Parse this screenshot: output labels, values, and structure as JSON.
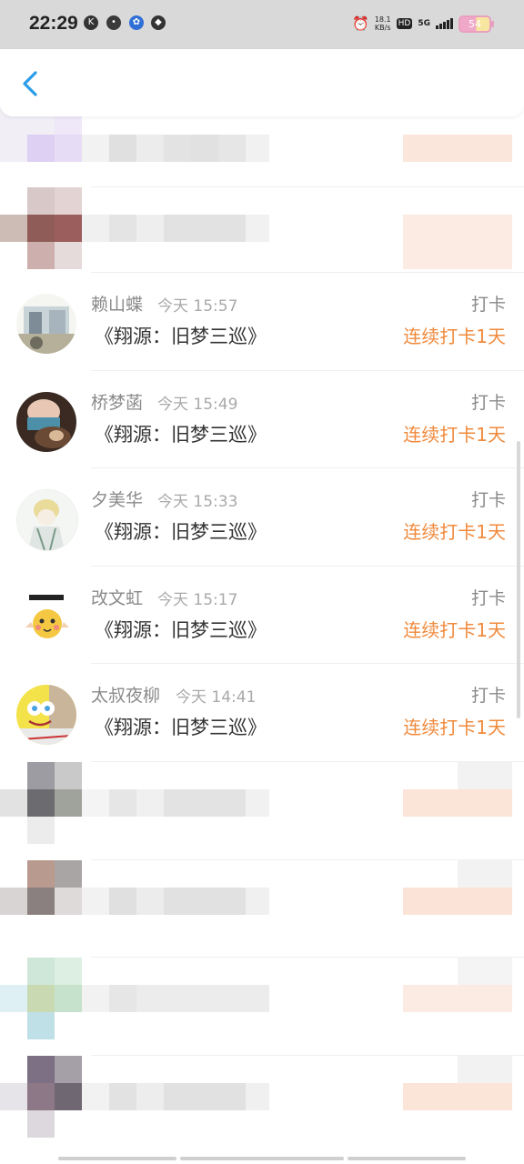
{
  "status_bar": {
    "time": "22:29",
    "net_speed": "18.1",
    "net_unit": "KB/s",
    "hd": "HD",
    "network": "5G",
    "battery": "54"
  },
  "header": {
    "back_icon": "chevron-left-icon",
    "accent_color": "#2a9de8"
  },
  "rows": [
    {
      "name": "赖山蝶",
      "time": "今天 15:57",
      "title": "《翔源：旧梦三巡》",
      "action": "打卡",
      "streak": "连续打卡1天"
    },
    {
      "name": "桥梦菡",
      "time": "今天 15:49",
      "title": "《翔源：旧梦三巡》",
      "action": "打卡",
      "streak": "连续打卡1天"
    },
    {
      "name": "夕美华",
      "time": "今天 15:33",
      "title": "《翔源：旧梦三巡》",
      "action": "打卡",
      "streak": "连续打卡1天"
    },
    {
      "name": "改文虹",
      "time": "今天 15:17",
      "title": "《翔源：旧梦三巡》",
      "action": "打卡",
      "streak": "连续打卡1天"
    },
    {
      "name": "太叔夜柳",
      "time": "今天 14:41",
      "title": "《翔源：旧梦三巡》",
      "action": "打卡",
      "streak": "连续打卡1天"
    }
  ],
  "colors": {
    "streak": "#f08a3c",
    "meta": "#8a8a8a"
  }
}
